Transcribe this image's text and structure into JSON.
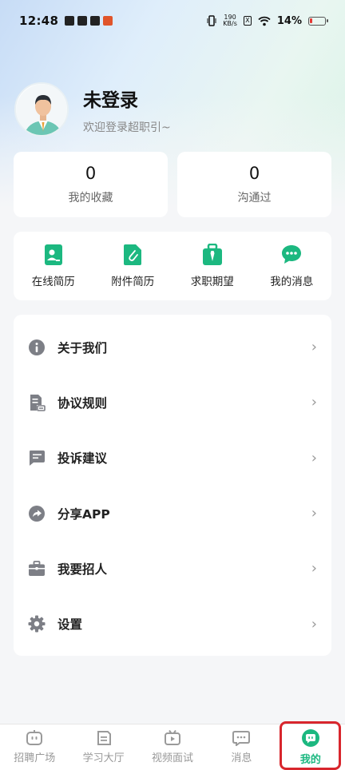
{
  "status_bar": {
    "time": "12:48",
    "speed_value": "190",
    "speed_unit": "KB/s",
    "sim_icon": "X",
    "battery_percent": "14%"
  },
  "profile": {
    "username": "未登录",
    "welcome_text": "欢迎登录超职引~"
  },
  "stats": [
    {
      "value": "0",
      "label": "我的收藏"
    },
    {
      "value": "0",
      "label": "沟通过"
    }
  ],
  "quick_actions": [
    {
      "label": "在线简历",
      "icon": "resume-icon"
    },
    {
      "label": "附件简历",
      "icon": "attachment-icon"
    },
    {
      "label": "求职期望",
      "icon": "briefcase-tie-icon"
    },
    {
      "label": "我的消息",
      "icon": "chat-icon"
    }
  ],
  "menu": [
    {
      "label": "关于我们",
      "icon": "info-icon"
    },
    {
      "label": "协议规则",
      "icon": "document-icon"
    },
    {
      "label": "投诉建议",
      "icon": "message-icon"
    },
    {
      "label": "分享APP",
      "icon": "share-icon"
    },
    {
      "label": "我要招人",
      "icon": "briefcase-icon"
    },
    {
      "label": "设置",
      "icon": "gear-icon"
    }
  ],
  "bottom_nav": [
    {
      "label": "招聘广场",
      "icon": "robot-icon"
    },
    {
      "label": "学习大厅",
      "icon": "book-icon"
    },
    {
      "label": "视频面试",
      "icon": "tv-icon"
    },
    {
      "label": "消息",
      "icon": "chat-bubble-icon"
    },
    {
      "label": "我的",
      "icon": "profile-bubble-icon",
      "active": true
    }
  ],
  "colors": {
    "accent": "#1cb880",
    "highlight": "#d8262d"
  }
}
